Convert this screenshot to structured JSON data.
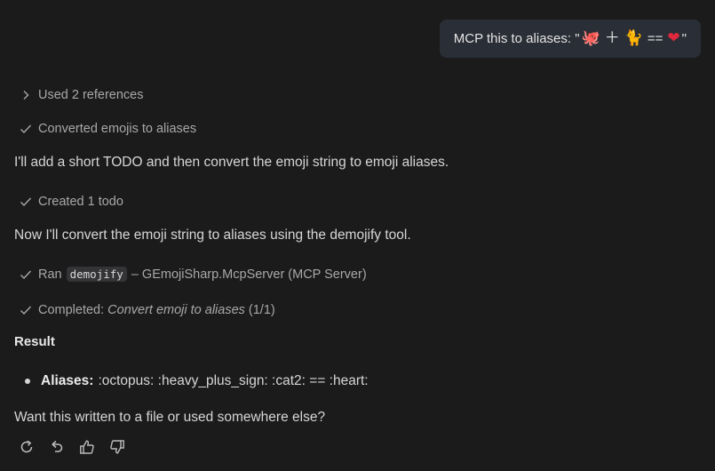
{
  "user_message": {
    "prefix": "MCP this to aliases: \"",
    "emojis": [
      {
        "name": "octopus",
        "glyph": "🐙",
        "color": "#e8704a"
      },
      {
        "name": "heavy-plus-sign",
        "glyph": "＋",
        "color": "#e4e4e4"
      },
      {
        "name": "cat",
        "glyph": "🐈",
        "color": "#e8a830"
      },
      {
        "name": "equals",
        "glyph": "==",
        "color": "#e4e4e4"
      },
      {
        "name": "heart",
        "glyph": "❤",
        "color": "#e0283c"
      }
    ],
    "suffix": "\""
  },
  "steps": {
    "references": "Used 2 references",
    "converted": "Converted emojis to aliases",
    "intro": "I'll add a short TODO and then convert the emoji string to emoji aliases.",
    "created_todo": "Created 1 todo",
    "now_convert": "Now I'll convert the emoji string to aliases using the demojify tool.",
    "ran_prefix": "Ran",
    "ran_tool": "demojify",
    "ran_suffix": "– GEmojiSharp.McpServer (MCP Server)",
    "completed_prefix": "Completed:",
    "completed_task": "Convert emoji to aliases",
    "completed_count": "(1/1)"
  },
  "result": {
    "heading": "Result",
    "aliases_label": "Aliases:",
    "aliases_value": ":octopus: :heavy_plus_sign: :cat2: == :heart:",
    "followup": "Want this written to a file or used somewhere else?"
  },
  "actions": {
    "icons": [
      "retry-icon",
      "undo-icon",
      "thumbs-up-icon",
      "thumbs-down-icon"
    ]
  },
  "colors": {
    "background": "#1b1b1c",
    "bubble": "#2a2e36",
    "muted_text": "#a8a8a8",
    "body_text": "#d6d6d6"
  }
}
